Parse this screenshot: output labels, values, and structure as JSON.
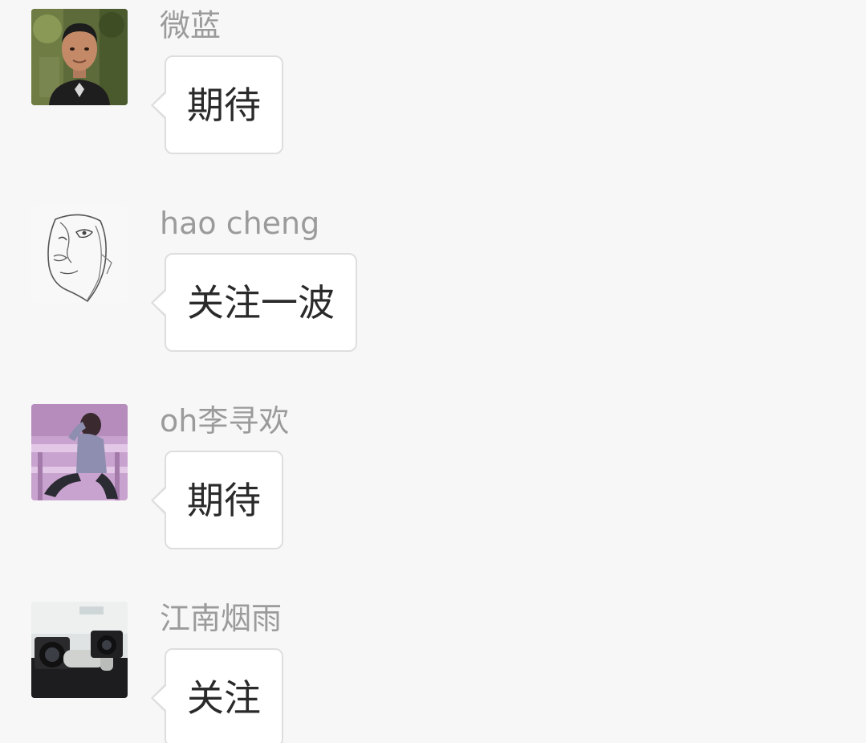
{
  "messages": [
    {
      "sender": "微蓝",
      "text": "期待",
      "avatar": "avatar-photo-man-outdoor"
    },
    {
      "sender": "hao  cheng",
      "text": "关注一波",
      "avatar": "avatar-sketch-face"
    },
    {
      "sender": "oh李寻欢",
      "text": "期待",
      "avatar": "avatar-photo-man-pink"
    },
    {
      "sender": "江南烟雨",
      "text": "关注",
      "avatar": "avatar-photo-cameras"
    }
  ],
  "colors": {
    "background": "#f7f7f7",
    "sender_name": "#9b9b9b",
    "bubble_bg": "#ffffff",
    "bubble_border": "#dedede",
    "message_text": "#2a2a2a"
  }
}
